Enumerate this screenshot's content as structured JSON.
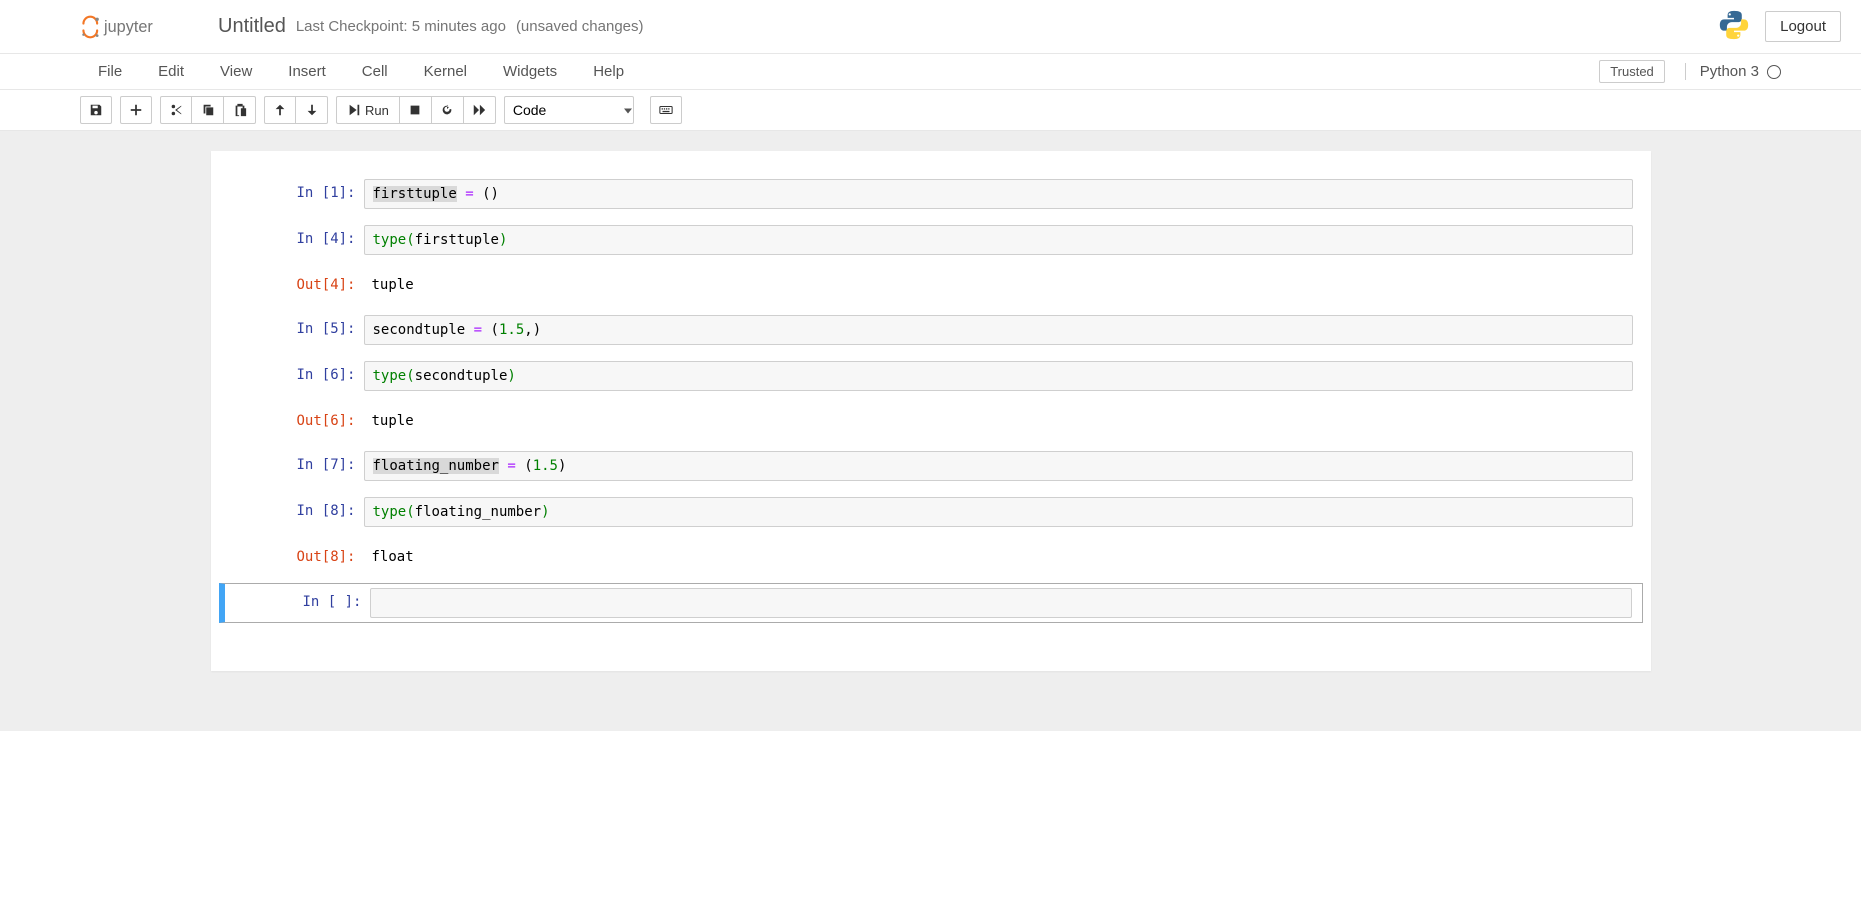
{
  "header": {
    "title": "Untitled",
    "checkpoint": "Last Checkpoint: 5 minutes ago",
    "unsaved": "(unsaved changes)",
    "logout": "Logout"
  },
  "menubar": {
    "items": [
      "File",
      "Edit",
      "View",
      "Insert",
      "Cell",
      "Kernel",
      "Widgets",
      "Help"
    ],
    "trusted": "Trusted",
    "kernel_name": "Python 3"
  },
  "toolbar": {
    "run_label": "Run",
    "cell_type": "Code"
  },
  "cells": [
    {
      "in_prompt": "In [1]:",
      "code_tokens": [
        {
          "t": "firsttuple",
          "c": "highlight-var"
        },
        {
          "t": " ",
          "c": ""
        },
        {
          "t": "=",
          "c": "tok-op"
        },
        {
          "t": " ",
          "c": ""
        },
        {
          "t": "()",
          "c": "tok-par"
        }
      ]
    },
    {
      "in_prompt": "In [4]:",
      "code_tokens": [
        {
          "t": "type",
          "c": "tok-call"
        },
        {
          "t": "(",
          "c": "tok-callpar"
        },
        {
          "t": "firsttuple",
          "c": "tok-var"
        },
        {
          "t": ")",
          "c": "tok-callpar"
        }
      ],
      "out_prompt": "Out[4]:",
      "output": "tuple"
    },
    {
      "in_prompt": "In [5]:",
      "code_tokens": [
        {
          "t": "secondtuple",
          "c": "tok-var"
        },
        {
          "t": " ",
          "c": ""
        },
        {
          "t": "=",
          "c": "tok-op"
        },
        {
          "t": " ",
          "c": ""
        },
        {
          "t": "(",
          "c": "tok-par"
        },
        {
          "t": "1.5",
          "c": "tok-num"
        },
        {
          "t": ",",
          "c": "tok-par"
        },
        {
          "t": ")",
          "c": "tok-par"
        }
      ]
    },
    {
      "in_prompt": "In [6]:",
      "code_tokens": [
        {
          "t": "type",
          "c": "tok-call"
        },
        {
          "t": "(",
          "c": "tok-callpar"
        },
        {
          "t": "secondtuple",
          "c": "tok-var"
        },
        {
          "t": ")",
          "c": "tok-callpar"
        }
      ],
      "out_prompt": "Out[6]:",
      "output": "tuple"
    },
    {
      "in_prompt": "In [7]:",
      "code_tokens": [
        {
          "t": "floating_number",
          "c": "highlight-var"
        },
        {
          "t": " ",
          "c": ""
        },
        {
          "t": "=",
          "c": "tok-op"
        },
        {
          "t": " ",
          "c": ""
        },
        {
          "t": "(",
          "c": "tok-par"
        },
        {
          "t": "1.5",
          "c": "tok-num"
        },
        {
          "t": ")",
          "c": "tok-par"
        }
      ]
    },
    {
      "in_prompt": "In [8]:",
      "code_tokens": [
        {
          "t": "type",
          "c": "tok-call"
        },
        {
          "t": "(",
          "c": "tok-callpar"
        },
        {
          "t": "floating_number",
          "c": "tok-var"
        },
        {
          "t": ")",
          "c": "tok-callpar"
        }
      ],
      "out_prompt": "Out[8]:",
      "output": "float"
    },
    {
      "in_prompt": "In [ ]:",
      "code_tokens": [],
      "selected": true
    }
  ]
}
